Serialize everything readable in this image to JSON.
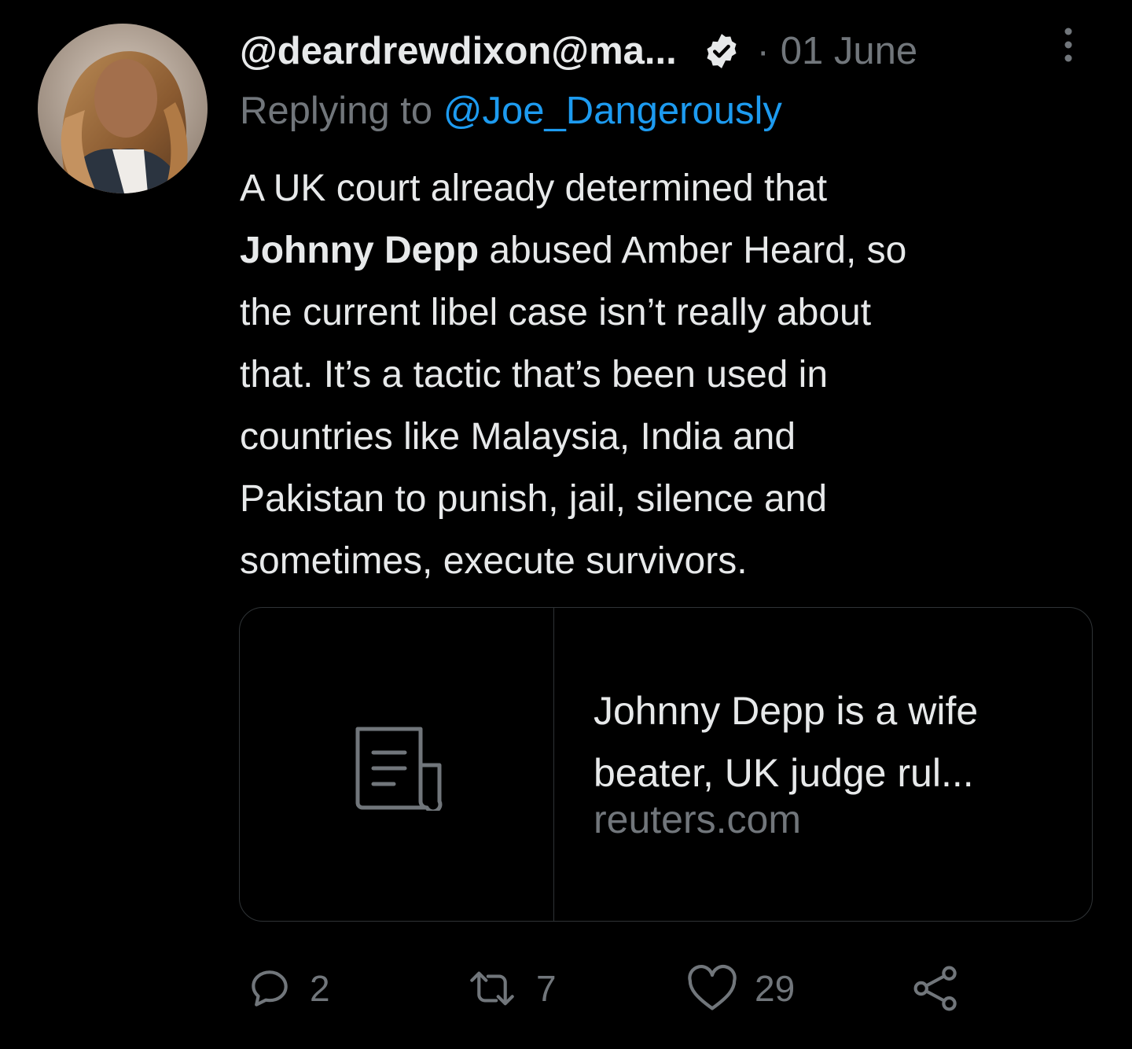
{
  "tweet": {
    "handle": "@deardrewdixon@ma...",
    "separator": "·",
    "date": "01 June",
    "reply_prefix": "Replying to ",
    "reply_mention": "@Joe_Dangerously",
    "text_lines": [
      "A UK court already determined that",
      "abused Amber Heard, so",
      "the current libel case isn’t really about",
      "that. It’s a tactic that’s been used in",
      "countries like Malaysia, India and",
      "Pakistan to punish, jail, silence and",
      "sometimes, execute survivors."
    ],
    "bold_name": "Johnny Depp"
  },
  "card": {
    "title_line1": "Johnny Depp is a wife",
    "title_line2": "beater, UK judge rul...",
    "domain": "reuters.com",
    "thumb_icon": "article-icon"
  },
  "actions": {
    "reply_count": "2",
    "retweet_count": "7",
    "like_count": "29"
  },
  "colors": {
    "background": "#000000",
    "text": "#e7e9ea",
    "muted": "#71767b",
    "link": "#1d9bf0",
    "border": "#2f3336"
  }
}
